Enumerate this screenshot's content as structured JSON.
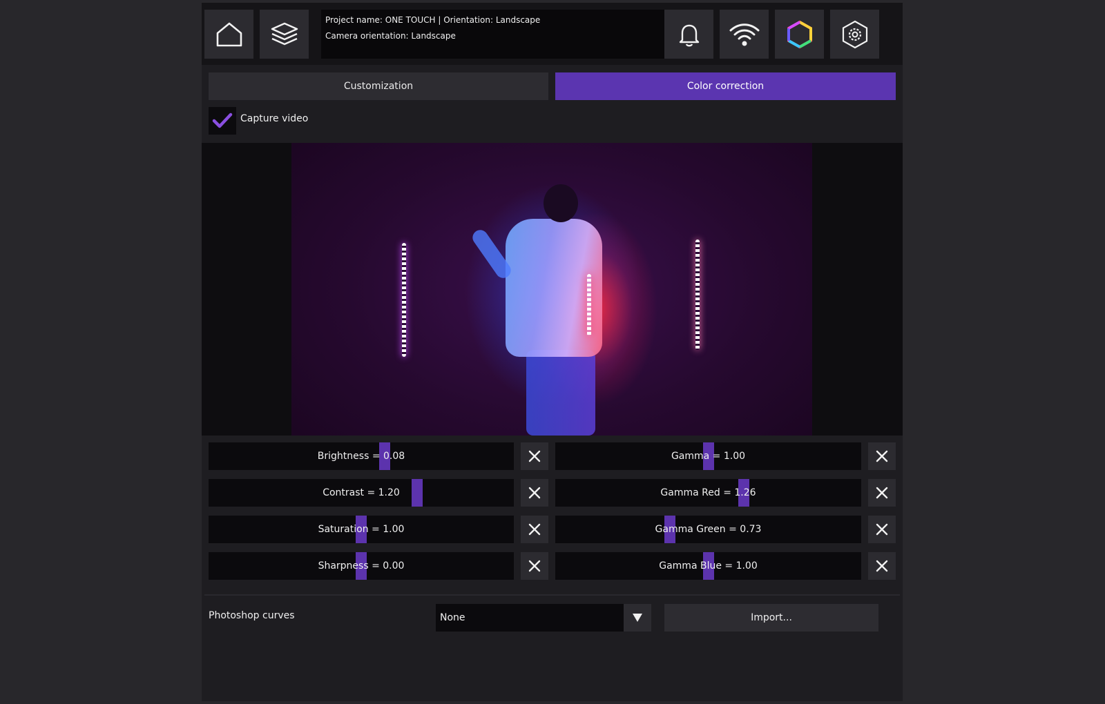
{
  "topbar": {
    "icons": [
      "home-icon",
      "layers-icon",
      "bell-icon",
      "wifi-icon",
      "color-hexagon-icon",
      "settings-icon"
    ],
    "project_info": "Project name: ONE TOUCH | Orientation: Landscape",
    "camera_info": "Camera orientation: Landscape"
  },
  "tabs": [
    {
      "label": "Customization",
      "active": false
    },
    {
      "label": "Color correction",
      "active": true
    }
  ],
  "capture": {
    "label": "Capture video",
    "checked": true
  },
  "sliders": [
    {
      "label": "Brightness = 0.08",
      "value": 0.08,
      "position": 0.58
    },
    {
      "label": "Contrast = 1.20",
      "value": 1.2,
      "position": 0.69
    },
    {
      "label": "Saturation = 1.00",
      "value": 1.0,
      "position": 0.5
    },
    {
      "label": "Sharpness = 0.00",
      "value": 0.0,
      "position": 0.5
    },
    {
      "label": "Gamma = 1.00",
      "value": 1.0,
      "position": 0.5
    },
    {
      "label": "Gamma Red = 1.26",
      "value": 1.26,
      "position": 0.62
    },
    {
      "label": "Gamma Green = 0.73",
      "value": 0.73,
      "position": 0.37
    },
    {
      "label": "Gamma Blue = 1.00",
      "value": 1.0,
      "position": 0.5
    }
  ],
  "curves": {
    "label": "Photoshop curves",
    "selected": "None",
    "import_label": "Import..."
  },
  "colors": {
    "accent": "#5b35b0",
    "check": "#8a4fe0",
    "background": "#1e1d21"
  }
}
